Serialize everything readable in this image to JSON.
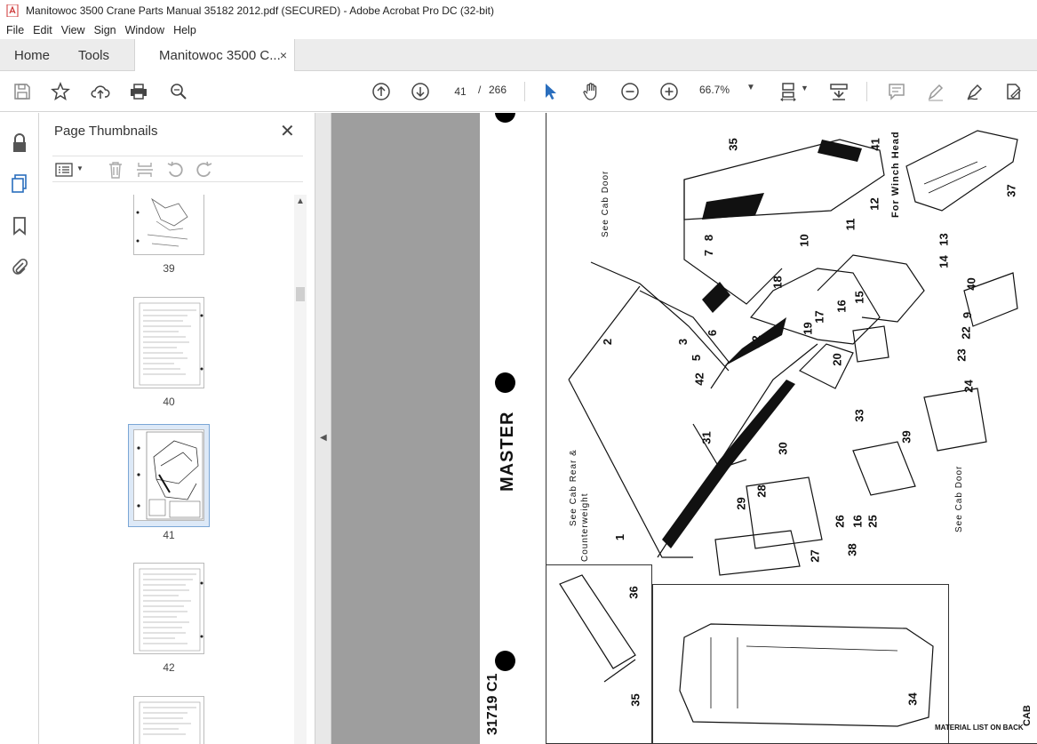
{
  "window": {
    "title": "Manitowoc 3500 Crane Parts Manual 35182 2012.pdf (SECURED) - Adobe Acrobat Pro DC (32-bit)"
  },
  "menu": [
    "File",
    "Edit",
    "View",
    "Sign",
    "Window",
    "Help"
  ],
  "tabs": {
    "home": "Home",
    "tools": "Tools",
    "doc": "Manitowoc 3500 C...",
    "doc_close": "×"
  },
  "toolbar": {
    "current_page": "41",
    "page_sep": "/",
    "total_pages": "266",
    "zoom": "66.7%",
    "zoom_caret": "▼"
  },
  "thumbnails": {
    "title": "Page Thumbnails",
    "close": "✕",
    "pages": [
      {
        "label": "39"
      },
      {
        "label": "40"
      },
      {
        "label": "41"
      },
      {
        "label": "42"
      }
    ],
    "selected_page": "41"
  },
  "document": {
    "master_label": "MASTER",
    "doc_number": "31719 C1",
    "footer_note": "MATERIAL LIST ON BACK",
    "section_label": "CAB",
    "notes": {
      "see_cab_door_top": "See Cab Door",
      "see_cab_rear": "See Cab Rear &",
      "counterweight": "Counterweight",
      "see_cab_door_right": "See Cab Door",
      "winch_head": "For Winch Head"
    },
    "callouts": [
      "35",
      "41",
      "12",
      "37",
      "8",
      "7",
      "10",
      "11",
      "13",
      "14",
      "40",
      "9",
      "2",
      "6",
      "18",
      "15",
      "16",
      "17",
      "19",
      "22",
      "3",
      "5",
      "32",
      "4",
      "20",
      "23",
      "42",
      "24",
      "33",
      "30",
      "31",
      "39",
      "1",
      "28",
      "29",
      "26",
      "25",
      "16",
      "27",
      "38",
      "36",
      "35",
      "34"
    ]
  },
  "colors": {
    "accent": "#2a6ebd",
    "doc_background": "#9e9e9e",
    "selection": "#dde9f7"
  }
}
